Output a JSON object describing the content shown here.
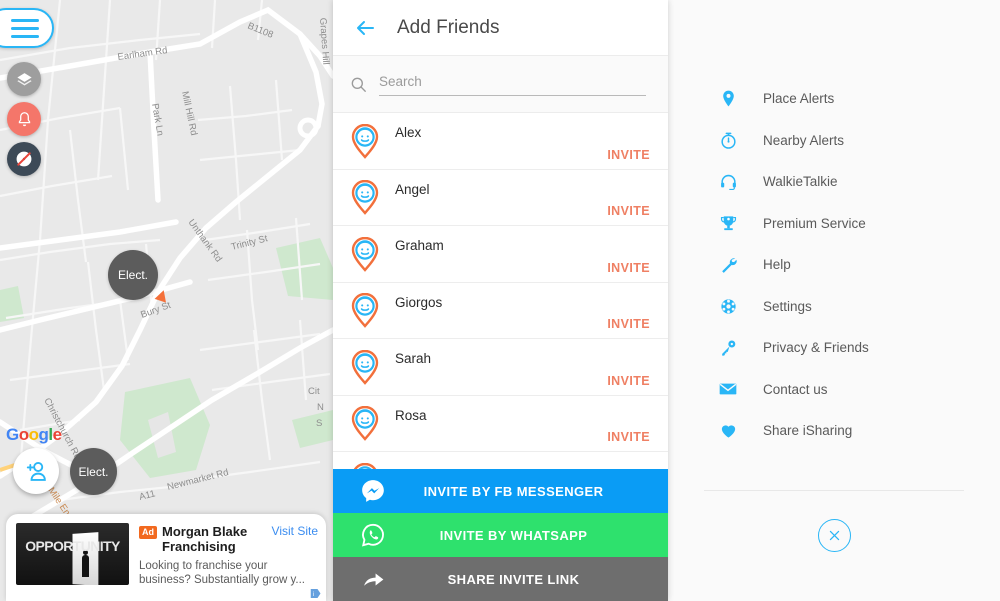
{
  "map": {
    "controls": {
      "menu_icon": "hamburger-icon",
      "layers_icon": "layers-icon",
      "alerts_icon": "bell-icon",
      "speed_icon": "speed-off-icon",
      "add_friend_icon": "add-person-icon"
    },
    "watermark": "Google",
    "markers": [
      {
        "label": "Elect."
      },
      {
        "label": "Elect."
      }
    ],
    "street_labels": [
      "Earlham Rd",
      "B1108",
      "Grapes Hill",
      "Park Ln",
      "Mill Hill Rd",
      "Unthank Rd",
      "Trinity St",
      "Bury St",
      "Christchurch Rd",
      "Newmarket Rd",
      "A11",
      "Mile End Rd",
      "Cit",
      "N",
      "S"
    ]
  },
  "ad": {
    "tag": "Ad",
    "title": "Morgan Blake Franchising",
    "cta": "Visit Site",
    "description": "Looking to franchise your business? Substantially grow y...",
    "thumb_text": "OPPORTUNITY"
  },
  "friends_panel": {
    "back_icon": "back-arrow-icon",
    "title": "Add Friends",
    "search": {
      "icon": "search-icon",
      "placeholder": "Search",
      "value": ""
    },
    "invite_label": "INVITE",
    "friends": [
      {
        "name": "Alex"
      },
      {
        "name": "Angel"
      },
      {
        "name": "Graham"
      },
      {
        "name": "Giorgos"
      },
      {
        "name": "Sarah"
      },
      {
        "name": "Rosa"
      }
    ],
    "actions": [
      {
        "label": "INVITE BY FB MESSENGER",
        "icon": "messenger-icon",
        "color": "#0a9cf5"
      },
      {
        "label": "INVITE BY WHATSAPP",
        "icon": "whatsapp-icon",
        "color": "#2ee16d"
      },
      {
        "label": "SHARE INVITE LINK",
        "icon": "share-arrow-icon",
        "color": "#6e6e6e"
      }
    ]
  },
  "menu_panel": {
    "items": [
      {
        "label": "Place Alerts",
        "icon": "map-pin-icon"
      },
      {
        "label": "Nearby Alerts",
        "icon": "stopwatch-icon"
      },
      {
        "label": "WalkieTalkie",
        "icon": "headset-icon"
      },
      {
        "label": "Premium Service",
        "icon": "trophy-icon"
      },
      {
        "label": "Help",
        "icon": "wrench-icon"
      },
      {
        "label": "Settings",
        "icon": "gear-icon"
      },
      {
        "label": "Privacy & Friends",
        "icon": "key-icon"
      },
      {
        "label": "Contact us",
        "icon": "envelope-icon"
      },
      {
        "label": "Share iSharing",
        "icon": "heart-icon"
      }
    ],
    "close_icon": "close-icon"
  },
  "colors": {
    "accent_cyan": "#29b6f6",
    "invite_orange": "#ef8064",
    "messenger_blue": "#0a9cf5",
    "whatsapp_green": "#2ee16d",
    "share_gray": "#6e6e6e"
  }
}
